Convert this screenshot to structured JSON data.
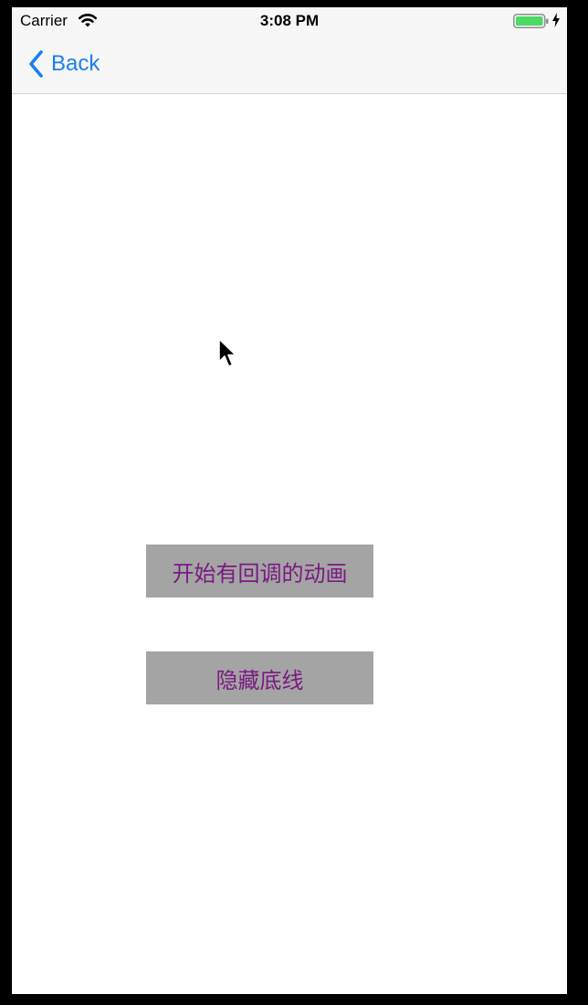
{
  "status_bar": {
    "carrier": "Carrier",
    "time": "3:08 PM",
    "wifi_icon": "wifi-icon",
    "battery_icon": "battery-icon",
    "charging_icon": "bolt-icon",
    "battery_color": "#4cd964"
  },
  "navbar": {
    "back_label": "Back",
    "back_icon": "chevron-left-icon",
    "accent": "#1a7ff0"
  },
  "main": {
    "buttons": [
      {
        "label": "开始有回调的动画"
      },
      {
        "label": "隐藏底线"
      }
    ],
    "button_bg": "#a4a4a4",
    "button_text_color": "#7a1a82"
  }
}
